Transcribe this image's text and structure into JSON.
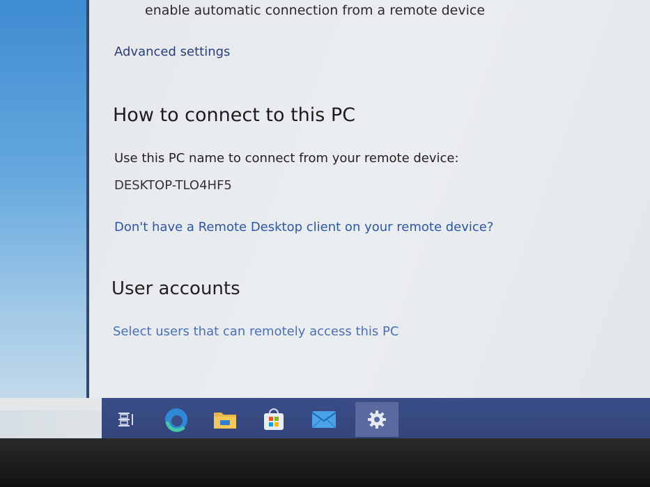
{
  "remote_desktop": {
    "auto_connection_text": "enable automatic connection from a remote device",
    "advanced_settings_link": "Advanced settings",
    "how_to_connect": {
      "heading": "How to connect to this PC",
      "instruction": "Use this PC name to connect from your remote device:",
      "pc_name": "DESKTOP-TLO4HF5",
      "client_link": "Don't have a Remote Desktop client on your remote device?"
    },
    "user_accounts": {
      "heading": "User accounts",
      "select_users_link": "Select users that can remotely access this PC"
    }
  },
  "taskbar": {
    "items": [
      {
        "icon": "task-view-icon"
      },
      {
        "icon": "edge-browser-icon"
      },
      {
        "icon": "file-explorer-icon"
      },
      {
        "icon": "microsoft-store-icon"
      },
      {
        "icon": "mail-icon"
      },
      {
        "icon": "settings-gear-icon",
        "active": true
      }
    ]
  },
  "colors": {
    "link": "#2d55a8",
    "taskbar": "#3b4d86",
    "desktop_accent": "#3e8bd1"
  }
}
